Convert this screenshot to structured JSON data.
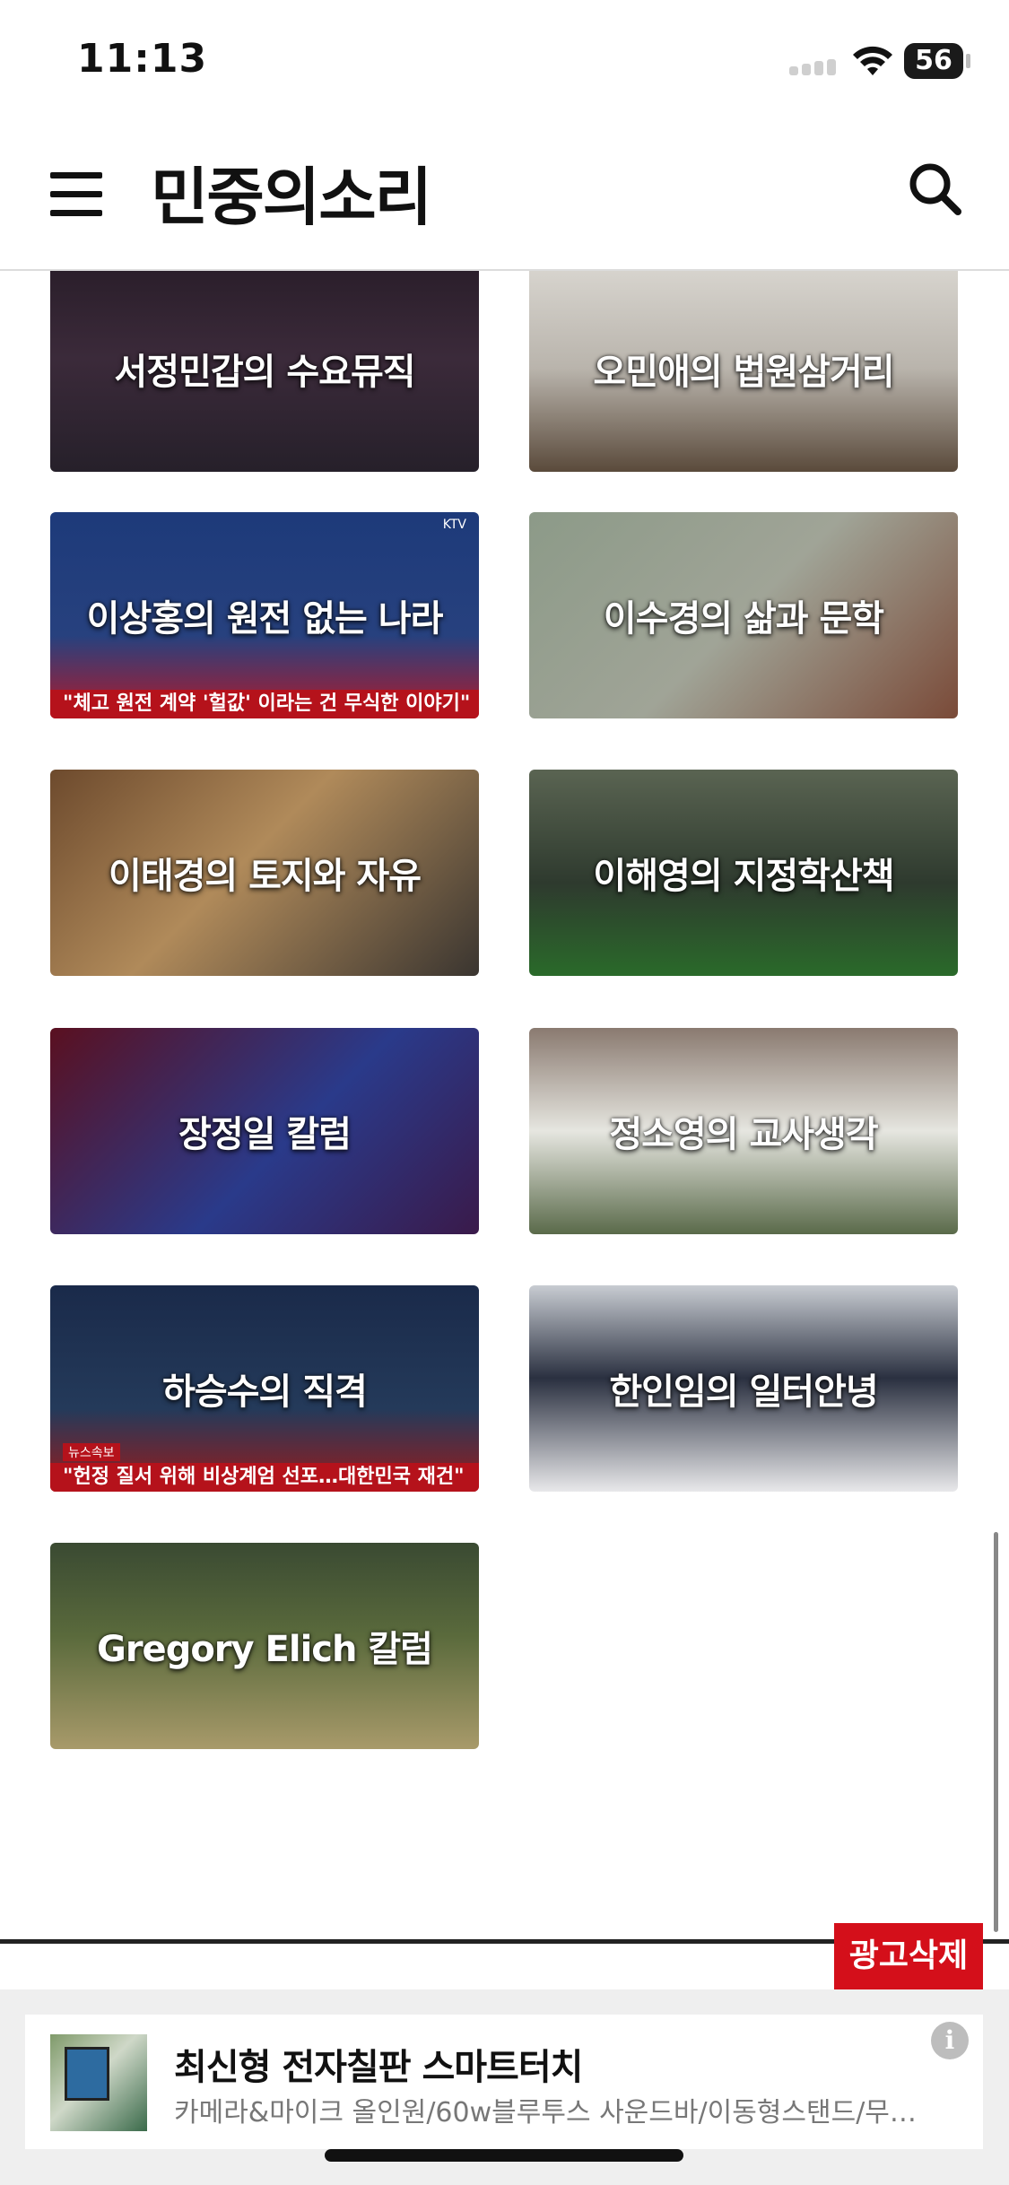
{
  "status_bar": {
    "time": "11:13",
    "battery": "56"
  },
  "header": {
    "logo": "민중의소리",
    "menu_icon": "hamburger-menu-icon",
    "search_icon": "search-icon"
  },
  "columns": [
    {
      "title": "서정민갑의 수요뮤직"
    },
    {
      "title": "오민애의 법원삼거리"
    },
    {
      "title": "이상홍의 원전 없는 나라",
      "caption": "\"체고 원전 계약 '헐값' 이라는 건 무식한 이야기\"",
      "tag": "KTV"
    },
    {
      "title": "이수경의 삶과 문학"
    },
    {
      "title": "이태경의 토지와 자유"
    },
    {
      "title": "이해영의 지정학산책"
    },
    {
      "title": "장정일 칼럼"
    },
    {
      "title": "정소영의 교사생각"
    },
    {
      "title": "하승수의 직격",
      "caption": "\"헌정 질서 위해 비상계엄 선포…대한민국 재건\"",
      "tag": "뉴스속보"
    },
    {
      "title": "한인임의 일터안녕"
    },
    {
      "title": "Gregory Elich 칼럼"
    }
  ],
  "ad": {
    "remove_label": "광고삭제",
    "title": "최신형 전자칠판 스마트터치",
    "description": "카메라&마이크 올인원/60w블루투스 사운드바/이동형스탠드/무…",
    "info_label": "i"
  },
  "colors": {
    "ad_remove_bg": "#d40f1a",
    "header_border": "#dcdcdc"
  }
}
